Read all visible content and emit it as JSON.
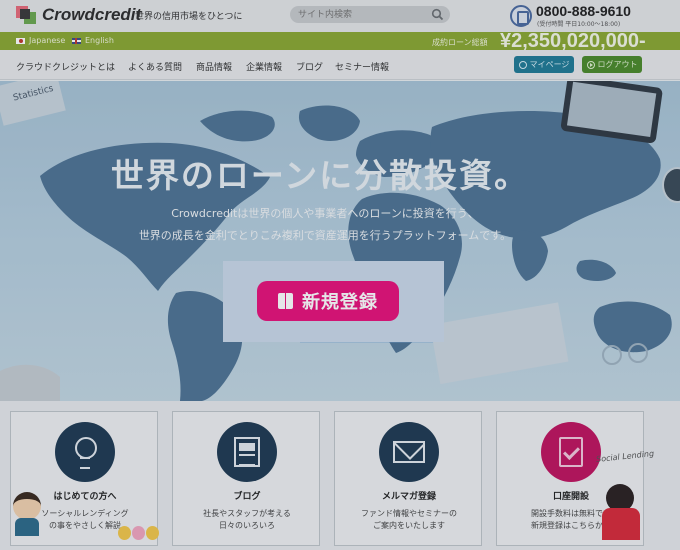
{
  "header": {
    "logo_text": "Crowdcredit",
    "tagline": "世界の信用市場をひとつに",
    "search_placeholder": "サイト内検索",
    "phone_number": "0800-888-9610",
    "phone_hours": "(受付時間 平日10:00～18:00)"
  },
  "greenbar": {
    "lang_japanese": "Japanese",
    "lang_english": "English",
    "loan_label": "成約ローン総額",
    "loan_total": "¥2,350,020,000-"
  },
  "nav": {
    "items": [
      {
        "label": "クラウドクレジットとは"
      },
      {
        "label": "よくある質問"
      },
      {
        "label": "商品情報"
      },
      {
        "label": "企業情報"
      },
      {
        "label": "ブログ"
      },
      {
        "label": "セミナー情報"
      }
    ],
    "mypage_label": "マイページ",
    "logout_label": "ログアウト"
  },
  "hero": {
    "title": "世界のローンに分散投資。",
    "subtitle_line1": "Crowdcreditは世界の個人や事業者へのローンに投資を行う、",
    "subtitle_line2": "世界の成長を金利でとりこみ複利で資産運用を行うプラットフォームです。",
    "signup_label": "新規登録",
    "statistics_label": "Statistics"
  },
  "cards": [
    {
      "title": "はじめての方へ",
      "desc1": "ソーシャルレンディング",
      "desc2": "の事をやさしく解説",
      "icon": "lightbulb-icon"
    },
    {
      "title": "ブログ",
      "desc1": "社長やスタッフが考える",
      "desc2": "日々のいろいろ",
      "icon": "document-icon"
    },
    {
      "title": "メルマガ登録",
      "desc1": "ファンド情報やセミナーの",
      "desc2": "ご案内をいたします",
      "icon": "mail-icon"
    },
    {
      "title": "口座開設",
      "desc1": "開設手数料は無料です",
      "desc2": "新規登録はこちらから",
      "icon": "checklist-icon"
    }
  ],
  "decor": {
    "social_lending_note": "Social Lending"
  },
  "colors": {
    "brand_green": "#8aa832",
    "signup_pink": "#e8107a",
    "card_icon_navy": "#1e3a52",
    "card_icon_pink": "#c0135f"
  }
}
